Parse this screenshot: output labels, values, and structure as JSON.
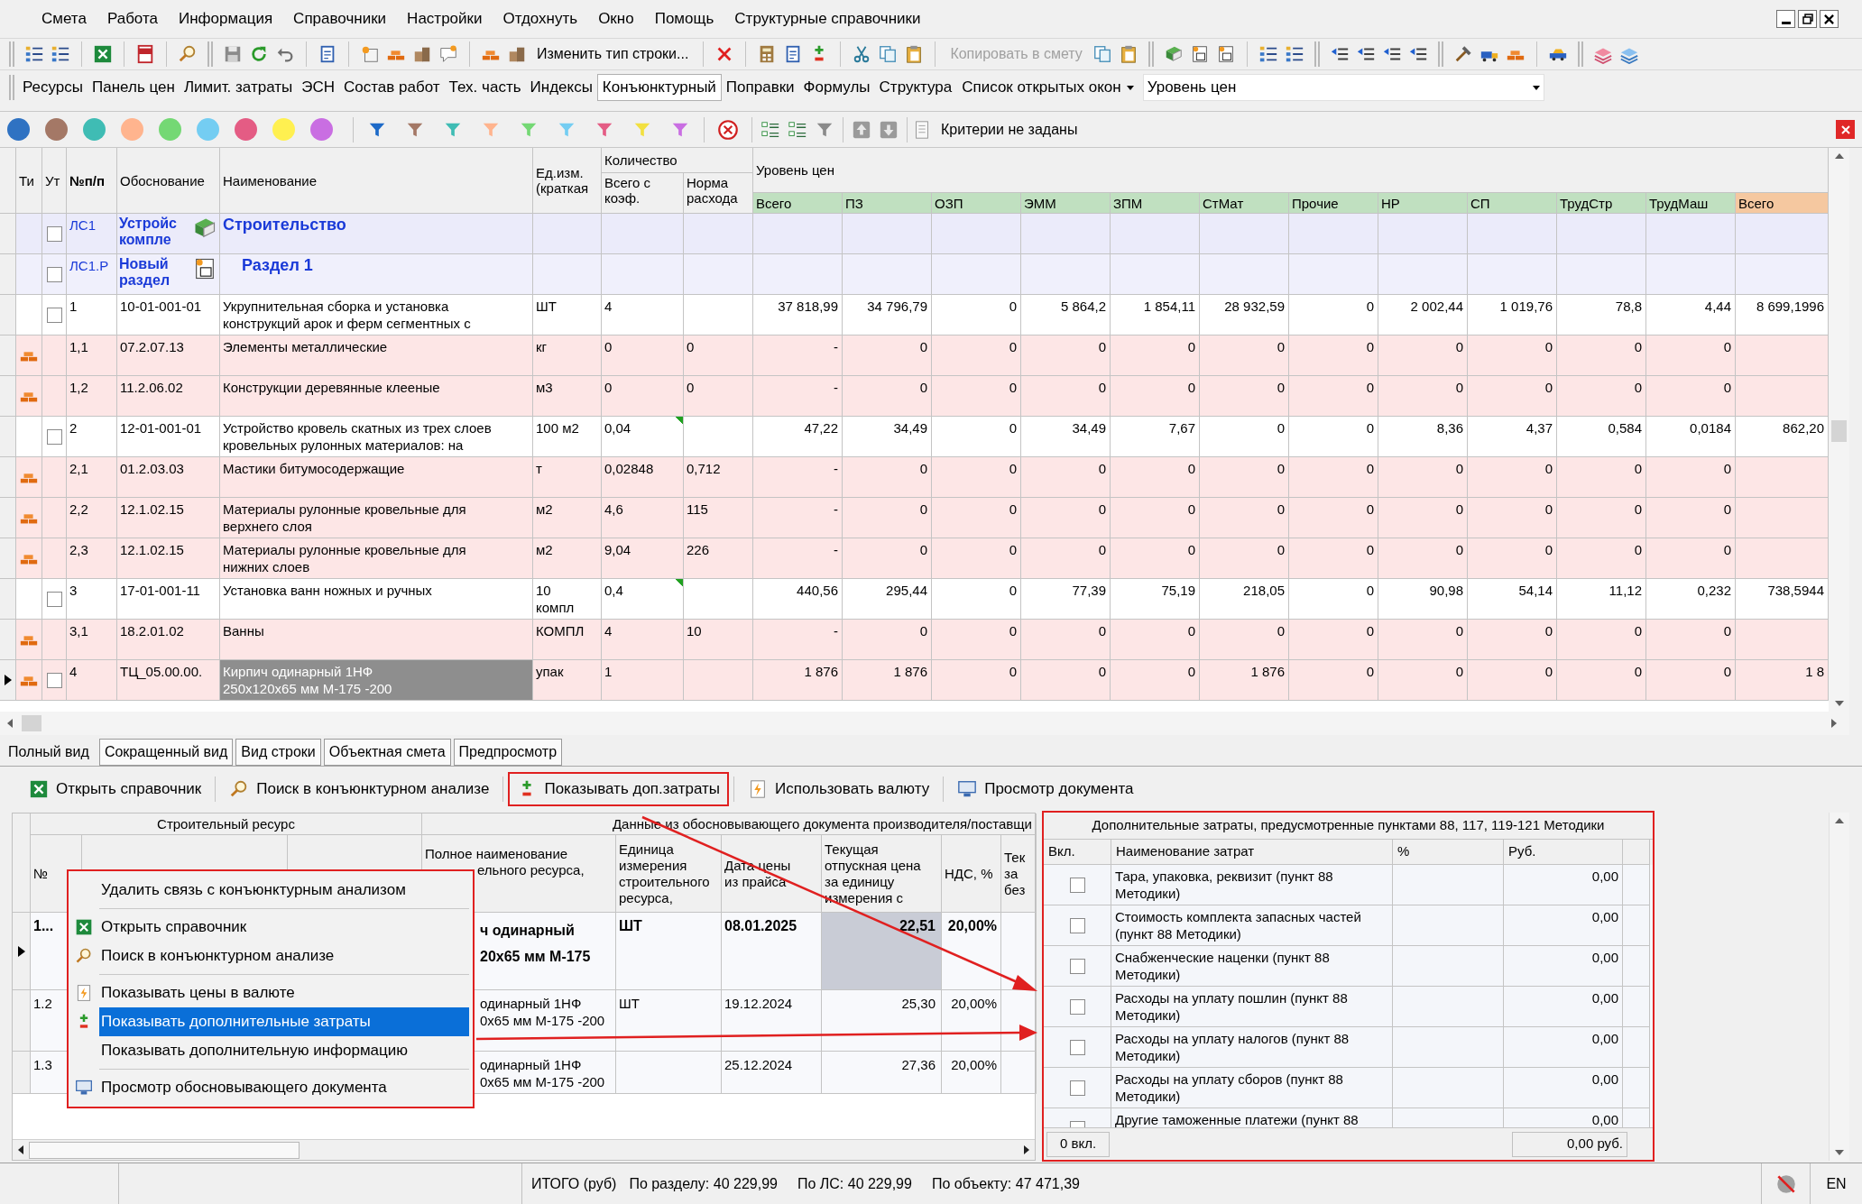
{
  "menu_bar": [
    "Смета",
    "Работа",
    "Информация",
    "Справочники",
    "Настройки",
    "Отдохнуть",
    "Окно",
    "Помощь",
    "Структурные справочники"
  ],
  "toolbar": [
    {
      "label": "Изменить тип строки...",
      "disabled": false
    },
    {
      "label": "Копировать в смету",
      "disabled": true
    }
  ],
  "panel_tabs": [
    {
      "label": "Ресурсы",
      "selected": false
    },
    {
      "label": "Панель цен",
      "selected": false
    },
    {
      "label": "Лимит. затраты",
      "selected": false
    },
    {
      "label": "ЭСН",
      "selected": false
    },
    {
      "label": "Состав работ",
      "selected": false
    },
    {
      "label": "Тех. часть",
      "selected": false
    },
    {
      "label": "Индексы",
      "selected": false
    },
    {
      "label": "Конъюнктурный",
      "selected": true
    },
    {
      "label": "Поправки",
      "selected": false
    },
    {
      "label": "Формулы",
      "selected": false
    },
    {
      "label": "Структура",
      "selected": false
    }
  ],
  "open_windows": {
    "label": "Список открытых окон"
  },
  "price_level": {
    "value": "Уровень цен"
  },
  "filters": {
    "color_marks": [
      {
        "color": "#2f72c2"
      },
      {
        "color": "#a47866"
      },
      {
        "color": "#3fbcb4"
      },
      {
        "color": "#ffb48e"
      },
      {
        "color": "#74d874"
      },
      {
        "color": "#74cdf2"
      },
      {
        "color": "#e45c84"
      },
      {
        "color": "#fff050"
      },
      {
        "color": "#c96ee2"
      }
    ],
    "color_filters": [
      {
        "color": "#1d6ac8"
      },
      {
        "color": "#a47866"
      },
      {
        "color": "#3fbcb4"
      },
      {
        "color": "#ffb48e"
      },
      {
        "color": "#74d874"
      },
      {
        "color": "#74cdf2"
      },
      {
        "color": "#e45c84"
      },
      {
        "color": "#f2e040"
      },
      {
        "color": "#c96ee2"
      }
    ],
    "criteria": "Критерии не заданы"
  },
  "grid": {
    "columns": [
      "Ти",
      "Ут",
      "№п/п",
      "Обоснование",
      "Наименование",
      "Ед.изм.\n(краткая"
    ],
    "quantity_group": "Количество",
    "quantity_columns": [
      "Всего с\nкоэф.",
      "Норма\nрасхода"
    ],
    "price_group": "Уровень цен",
    "price_columns": [
      {
        "label": "Всего",
        "color": "#c0e0c0"
      },
      {
        "label": "ПЗ",
        "color": "#c0e0c0"
      },
      {
        "label": "ОЗП",
        "color": "#c0e0c0"
      },
      {
        "label": "ЭММ",
        "color": "#c0e0c0"
      },
      {
        "label": "ЗПМ",
        "color": "#c0e0c0"
      },
      {
        "label": "СтМат",
        "color": "#c0e0c0"
      },
      {
        "label": "Прочие",
        "color": "#c0e0c0"
      },
      {
        "label": "НР",
        "color": "#c0e0c0"
      },
      {
        "label": "СП",
        "color": "#c0e0c0"
      },
      {
        "label": "ТрудСтр",
        "color": "#c0e0c0"
      },
      {
        "label": "ТрудМаш",
        "color": "#c0e0c0"
      },
      {
        "label": "Всего",
        "color": "#f5c8a0"
      }
    ],
    "rows": [
      {
        "kind": "estimate",
        "selected": false,
        "checked": false,
        "num": "ЛС1",
        "code": "Устройс\nкомпле",
        "name": "Строительство"
      },
      {
        "kind": "section",
        "selected": false,
        "checked": false,
        "num": "ЛС1.Р",
        "code": "Новый\nраздел",
        "name": "Раздел 1"
      },
      {
        "kind": "work",
        "selected": false,
        "checked": false,
        "num": "1",
        "code": "10-01-001-01",
        "name": "Укрупнительная сборка и установка\nконструкций арок и ферм сегментных с",
        "unit": "ШТ",
        "qty": "4",
        "marked": false,
        "values": [
          "37 818,99",
          "34 796,79",
          "0",
          "5 864,2",
          "1 854,11",
          "28 932,59",
          "0",
          "2 002,44",
          "1 019,76",
          "78,8",
          "4,44",
          "8 699,1996"
        ]
      },
      {
        "kind": "resource",
        "selected": false,
        "num": "1,1",
        "code": "07.2.07.13",
        "name": "Элементы металлические",
        "unit": "кг",
        "qty": "0",
        "norm": "0",
        "values": [
          "-",
          "0",
          "0",
          "0",
          "0",
          "0",
          "0",
          "0",
          "0",
          "0",
          "0"
        ]
      },
      {
        "kind": "resource",
        "selected": false,
        "num": "1,2",
        "code": "11.2.06.02",
        "name": "Конструкции деревянные клееные",
        "unit": "м3",
        "qty": "0",
        "norm": "0",
        "values": [
          "-",
          "0",
          "0",
          "0",
          "0",
          "0",
          "0",
          "0",
          "0",
          "0",
          "0"
        ]
      },
      {
        "kind": "work",
        "selected": false,
        "checked": false,
        "num": "2",
        "code": "12-01-001-01",
        "name": "Устройство кровель скатных из трех слоев\nкровельных рулонных материалов: на",
        "unit": "100 м2",
        "qty": "0,04",
        "marked": true,
        "values": [
          "47,22",
          "34,49",
          "0",
          "34,49",
          "7,67",
          "0",
          "0",
          "8,36",
          "4,37",
          "0,584",
          "0,0184",
          "862,20"
        ]
      },
      {
        "kind": "resource",
        "selected": false,
        "num": "2,1",
        "code": "01.2.03.03",
        "name": "Мастики битумосодержащие",
        "unit": "т",
        "qty": "0,02848",
        "norm": "0,712",
        "values": [
          "-",
          "0",
          "0",
          "0",
          "0",
          "0",
          "0",
          "0",
          "0",
          "0",
          "0"
        ]
      },
      {
        "kind": "resource",
        "selected": false,
        "num": "2,2",
        "code": "12.1.02.15",
        "name": "Материалы рулонные кровельные для\nверхнего слоя",
        "unit": "м2",
        "qty": "4,6",
        "norm": "115",
        "values": [
          "-",
          "0",
          "0",
          "0",
          "0",
          "0",
          "0",
          "0",
          "0",
          "0",
          "0"
        ]
      },
      {
        "kind": "resource",
        "selected": false,
        "num": "2,3",
        "code": "12.1.02.15",
        "name": "Материалы рулонные кровельные для\nнижних слоев",
        "unit": "м2",
        "qty": "9,04",
        "norm": "226",
        "values": [
          "-",
          "0",
          "0",
          "0",
          "0",
          "0",
          "0",
          "0",
          "0",
          "0",
          "0"
        ]
      },
      {
        "kind": "work",
        "selected": false,
        "checked": false,
        "num": "3",
        "code": "17-01-001-11",
        "name": "Установка ванн ножных и ручных",
        "unit": "10\nкомпл",
        "qty": "0,4",
        "marked": true,
        "values": [
          "440,56",
          "295,44",
          "0",
          "77,39",
          "75,19",
          "218,05",
          "0",
          "90,98",
          "54,14",
          "11,12",
          "0,232",
          "738,5944"
        ]
      },
      {
        "kind": "resource",
        "selected": false,
        "num": "3,1",
        "code": "18.2.01.02",
        "name": "Ванны",
        "unit": "КОМПЛ",
        "qty": "4",
        "norm": "10",
        "values": [
          "-",
          "0",
          "0",
          "0",
          "0",
          "0",
          "0",
          "0",
          "0",
          "0",
          "0"
        ]
      },
      {
        "kind": "resource",
        "selected": true,
        "checked": false,
        "num": "4",
        "code": "ТЦ_05.00.00.",
        "name": "Кирпич одинарный 1НФ\n250х120х65 мм М-175 -200",
        "unit": "упак",
        "qty": "1",
        "values": [
          "1 876",
          "1 876",
          "0",
          "0",
          "0",
          "1 876",
          "0",
          "0",
          "0",
          "0",
          "0",
          "1 8"
        ]
      }
    ]
  },
  "view_tabs": [
    {
      "label": "Полный вид",
      "selected": true
    },
    {
      "label": "Сокращенный вид",
      "selected": false
    },
    {
      "label": "Вид строки",
      "selected": false
    },
    {
      "label": "Объектная смета",
      "selected": false
    },
    {
      "label": "Предпросмотр",
      "selected": false
    }
  ],
  "lower_toolbar": [
    {
      "label": "Открыть справочник",
      "highlighted": false
    },
    {
      "label": "Поиск в конъюнктурном анализе",
      "highlighted": false
    },
    {
      "label": "Показывать доп.затраты",
      "highlighted": true
    },
    {
      "label": "Использовать валюту",
      "highlighted": false
    },
    {
      "label": "Просмотр документа",
      "highlighted": false
    }
  ],
  "resource_grid": {
    "group_left": "Строительный ресурс",
    "group_right": "Данные из обосновывающего документа производителя/поставщи",
    "columns": [
      [
        "№"
      ],
      [
        "Полное наименование",
        "ельного ресурса,"
      ],
      [
        "Единица",
        "измерения",
        "строительного",
        "ресурса,"
      ],
      [
        "Дата цены",
        "из прайса"
      ],
      [
        "Текущая",
        "отпускная цена",
        "за единицу",
        "измерения с"
      ],
      [
        "НДС, %"
      ],
      [
        "Тек",
        "за",
        "без"
      ]
    ],
    "rows": [
      {
        "selected": true,
        "num": "1...",
        "name": [
          "ч одинарный",
          "20х65 мм М-175"
        ],
        "unit": "ШТ",
        "date": "08.01.2025",
        "price": "22,51",
        "vat": "20,00%"
      },
      {
        "selected": false,
        "num": "1.2",
        "name": [
          "одинарный 1НФ",
          "0х65 мм М-175 -200"
        ],
        "unit": "ШТ",
        "date": "19.12.2024",
        "price": "25,30",
        "vat": "20,00%"
      },
      {
        "selected": false,
        "num": "1.3",
        "name": [
          "одинарный 1НФ",
          "0х65 мм М-175 -200"
        ],
        "date": "25.12.2024",
        "price": "27,36",
        "vat": "20,00%"
      }
    ]
  },
  "context_menu": {
    "highlighted": true,
    "items": [
      {
        "kind": "item",
        "label": "Удалить связь с конъюнктурным анализом",
        "selected": false
      },
      {
        "kind": "separator"
      },
      {
        "kind": "item",
        "label": "Открыть справочник",
        "selected": false
      },
      {
        "kind": "item",
        "label": "Поиск в конъюнктурном анализе",
        "selected": false
      },
      {
        "kind": "separator"
      },
      {
        "kind": "item",
        "label": "Показывать цены в валюте",
        "selected": false
      },
      {
        "kind": "item",
        "label": "Показывать дополнительные затраты",
        "selected": true
      },
      {
        "kind": "item",
        "label": "Показывать дополнительную информацию",
        "selected": false
      },
      {
        "kind": "separator"
      },
      {
        "kind": "item",
        "label": "Просмотр обосновывающего документа",
        "selected": false
      }
    ]
  },
  "extra_costs": {
    "highlighted": true,
    "title": "Дополнительные затраты, предусмотренные пунктами 88, 117, 119-121 Методики",
    "columns": [
      "Вкл.",
      "Наименование затрат",
      "%",
      "Руб."
    ],
    "rows": [
      {
        "checked": false,
        "name": "Тара, упаковка, реквизит (пункт 88 Методики)",
        "rub": "0,00"
      },
      {
        "checked": false,
        "name": "Стоимость комплекта запасных частей (пункт 88 Методики)",
        "rub": "0,00"
      },
      {
        "checked": false,
        "name": "Снабженческие наценки (пункт 88 Методики)",
        "rub": "0,00"
      },
      {
        "checked": false,
        "name": "Расходы на уплату пошлин (пункт 88 Методики)",
        "rub": "0,00"
      },
      {
        "checked": false,
        "name": "Расходы на уплату налогов (пункт 88 Методики)",
        "rub": "0,00"
      },
      {
        "checked": false,
        "name": "Расходы на уплату сборов (пункт 88 Методики)",
        "rub": "0,00"
      },
      {
        "checked": false,
        "name": "Другие таможенные платежи (пункт 88",
        "rub": "0,00"
      }
    ],
    "footer_count": "0 вкл.",
    "footer_total": "0,00 руб."
  },
  "status_bar": {
    "label": "ИТОГО (руб)",
    "section_total": "По разделу: 40 229,99",
    "estimate_total": "По ЛС: 40 229,99",
    "object_total": "По объекту: 47 471,39",
    "language": "EN"
  }
}
